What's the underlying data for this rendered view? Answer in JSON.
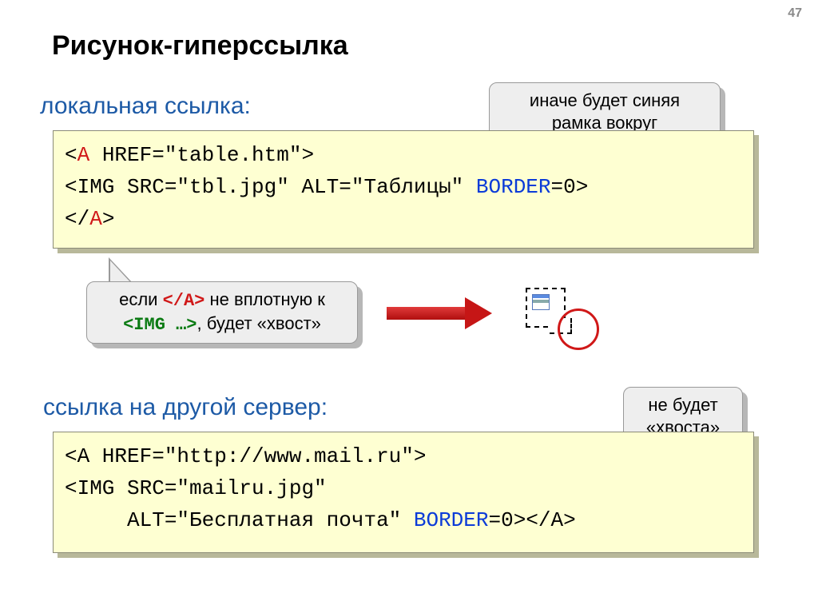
{
  "page_number": "47",
  "title": "Рисунок-гиперссылка",
  "subtitle1": "локальная ссылка:",
  "subtitle2": "ссылка на другой сервер:",
  "code1": {
    "l1_pre": "<",
    "l1_tag": "A",
    "l1_post": " HREF=\"table.htm\">",
    "l2_pre": "<IMG SRC=\"tbl.jpg\" ALT=\"Таблицы\" ",
    "l2_attr": "BORDER",
    "l2_post": "=0>",
    "l3_pre": "</",
    "l3_tag": "A",
    "l3_post": ">"
  },
  "code2": {
    "l1": "<A HREF=\"http://www.mail.ru\">",
    "l2": "<IMG SRC=\"mailru.jpg\"",
    "l3_pre": "     ALT=\"Бесплатная почта\" ",
    "l3_attr": "BORDER",
    "l3_mid": "=0>",
    "l3_close": "</A>"
  },
  "callout1_line1": "иначе будет синяя",
  "callout1_line2": "рамка вокруг",
  "callout2_pre": "если ",
  "callout2_red": "</A>",
  "callout2_mid": " не вплотную к",
  "callout2_green": "<IMG …>",
  "callout2_post": ", будет «хвост»",
  "callout3_line1": "не будет",
  "callout3_line2": "«хвоста»"
}
